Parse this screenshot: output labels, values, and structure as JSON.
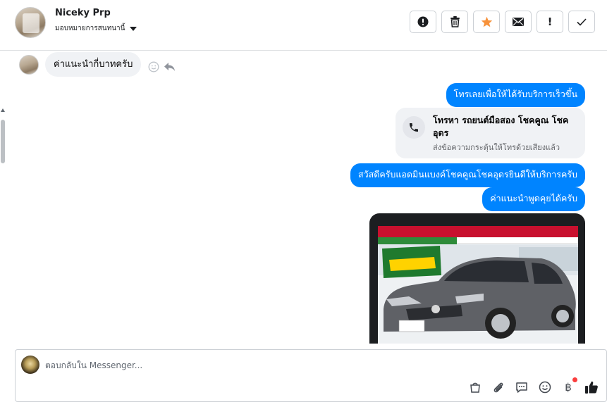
{
  "header": {
    "name": "Niceky Prp",
    "assign_label": "มอบหมายการสนทนานี้",
    "toolbar": [
      {
        "name": "spam-report-button",
        "icon": "alert-circle-icon"
      },
      {
        "name": "delete-button",
        "icon": "trash-icon"
      },
      {
        "name": "star-button",
        "icon": "star-icon"
      },
      {
        "name": "mark-unread-button",
        "icon": "envelope-icon"
      },
      {
        "name": "follow-up-button",
        "icon": "exclamation-icon",
        "text": "!"
      },
      {
        "name": "done-button",
        "icon": "check-icon"
      }
    ]
  },
  "thread": {
    "incoming": [
      {
        "text": "ค่าแนะนำกี่บาทครับ"
      }
    ],
    "outgoing": [
      {
        "text": "โทรเลยเพื่อให้ได้รับบริการเร็วขึ้น"
      },
      {
        "text": "สวัสดีครับแอดมินแบงค์โชคคูณโชคอุดรยินดีให้บริการครับ"
      },
      {
        "text": "ค่าแนะนำพูดคุยได้ครับ"
      }
    ],
    "call_card": {
      "title": "โทรหา รถยนต์มือสอง โชคคูณ โชค อุดร",
      "subtitle": "ส่งข้อความกระตุ้นให้โทรด้วยเสียงแล้ว"
    },
    "image_card": {
      "icon": "car-photo-icon"
    }
  },
  "composer": {
    "placeholder": "ตอบกลับใน Messenger...",
    "tools": [
      "shopping-bag-icon",
      "paperclip-icon",
      "saved-replies-icon",
      "emoji-icon",
      "baht-icon",
      "thumbs-up-icon"
    ],
    "baht_symbol": "฿"
  },
  "colors": {
    "accent": "#0084ff",
    "star": "#f7923b",
    "notification": "#fa3e3e"
  }
}
